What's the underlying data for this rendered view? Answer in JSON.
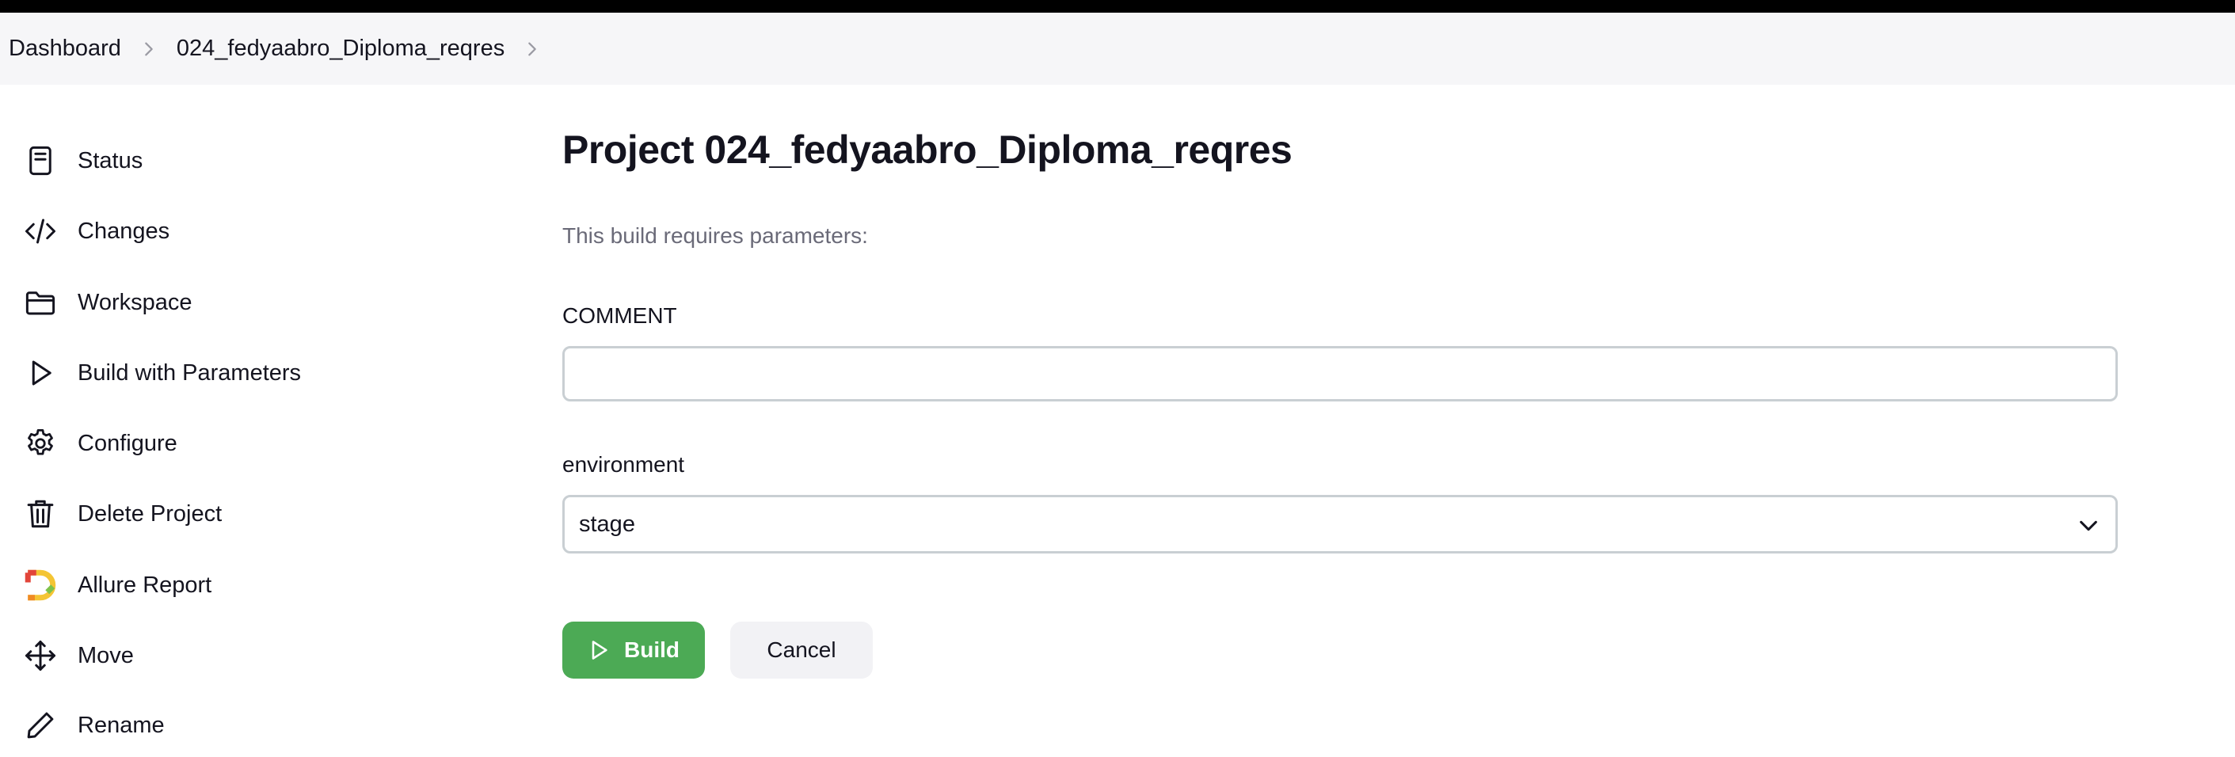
{
  "breadcrumb": {
    "items": [
      "Dashboard",
      "024_fedyaabro_Diploma_reqres"
    ]
  },
  "sidebar": {
    "items": [
      {
        "label": "Status",
        "icon": "status-document-icon"
      },
      {
        "label": "Changes",
        "icon": "code-brackets-icon"
      },
      {
        "label": "Workspace",
        "icon": "folder-icon"
      },
      {
        "label": "Build with Parameters",
        "icon": "play-icon"
      },
      {
        "label": "Configure",
        "icon": "gear-icon"
      },
      {
        "label": "Delete Project",
        "icon": "trash-icon"
      },
      {
        "label": "Allure Report",
        "icon": "allure-logo-icon"
      },
      {
        "label": "Move",
        "icon": "move-arrows-icon"
      },
      {
        "label": "Rename",
        "icon": "pencil-icon"
      }
    ]
  },
  "main": {
    "title": "Project 024_fedyaabro_Diploma_reqres",
    "subtitle": "This build requires parameters:",
    "params": [
      {
        "label": "COMMENT",
        "type": "text",
        "value": ""
      },
      {
        "label": "environment",
        "type": "select",
        "value": "stage"
      }
    ],
    "build_label": "Build",
    "cancel_label": "Cancel"
  },
  "colors": {
    "build_button": "#4caa55",
    "breadcrumb_bg": "#f6f6f8",
    "input_border": "#c9cfd3"
  }
}
